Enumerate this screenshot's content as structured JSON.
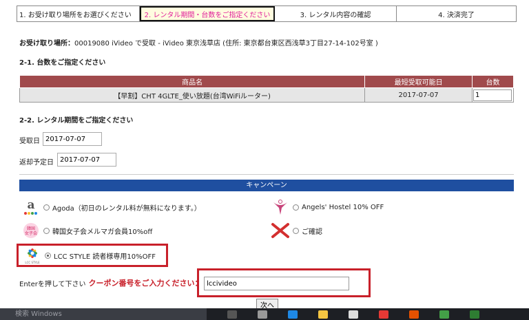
{
  "steps": [
    "1. お受け取り場所をお選びください",
    "2. レンタル期間・台数をご指定ください",
    "3. レンタル内容の確認",
    "4. 決済完了"
  ],
  "pickup": {
    "label": "お受け取り場所：",
    "value": "00019080 iVideo で受取 - iVideo 東京浅草店 (住所: 東京都台東区西浅草3丁目27-14-102号室 )"
  },
  "section_quantity": "2-1. 台数をご指定ください",
  "table": {
    "headers": [
      "商品名",
      "最短受取可能日",
      "台数"
    ],
    "row": {
      "name": "【早割】CHT 4GLTE_使い放題(台湾WiFiルーター)",
      "date": "2017-07-07",
      "qty": "1"
    }
  },
  "section_period": "2-2. レンタル期間をご指定ください",
  "receive": {
    "label": "受取日",
    "value": "2017-07-07"
  },
  "return": {
    "label": "返却予定日",
    "value": "2017-07-07"
  },
  "campaign_title": "キャンペーン",
  "coupons": [
    {
      "label": "Agoda（初日のレンタル料が無料になります。）",
      "icon": "agoda-logo-icon"
    },
    {
      "label": "Angels' Hostel 10% OFF",
      "icon": "angels-hostel-logo-icon"
    },
    {
      "label": "韓国女子会メルマガ会員10%off",
      "icon": "korea-girls-logo-icon"
    },
    {
      "label": "ご確認",
      "icon": "red-x-icon"
    },
    {
      "label": "LCC STYLE 読者様専用10%OFF",
      "icon": "lcc-style-logo-icon"
    }
  ],
  "logo_texts": {
    "korea": "韓国\n女子会",
    "lcc": "LCC STYLE"
  },
  "enter": {
    "prefix": "Enterを押して下さい",
    "prompt": "クーポン番号をご入力ください：",
    "value": "lccivideo"
  },
  "next_label": "次へ",
  "taskbar": {
    "search_placeholder": "検索 Windows"
  },
  "colors": {
    "table_header": "#a04a4c",
    "campaign_bar": "#1f4fa0",
    "highlight": "#c8202a"
  }
}
